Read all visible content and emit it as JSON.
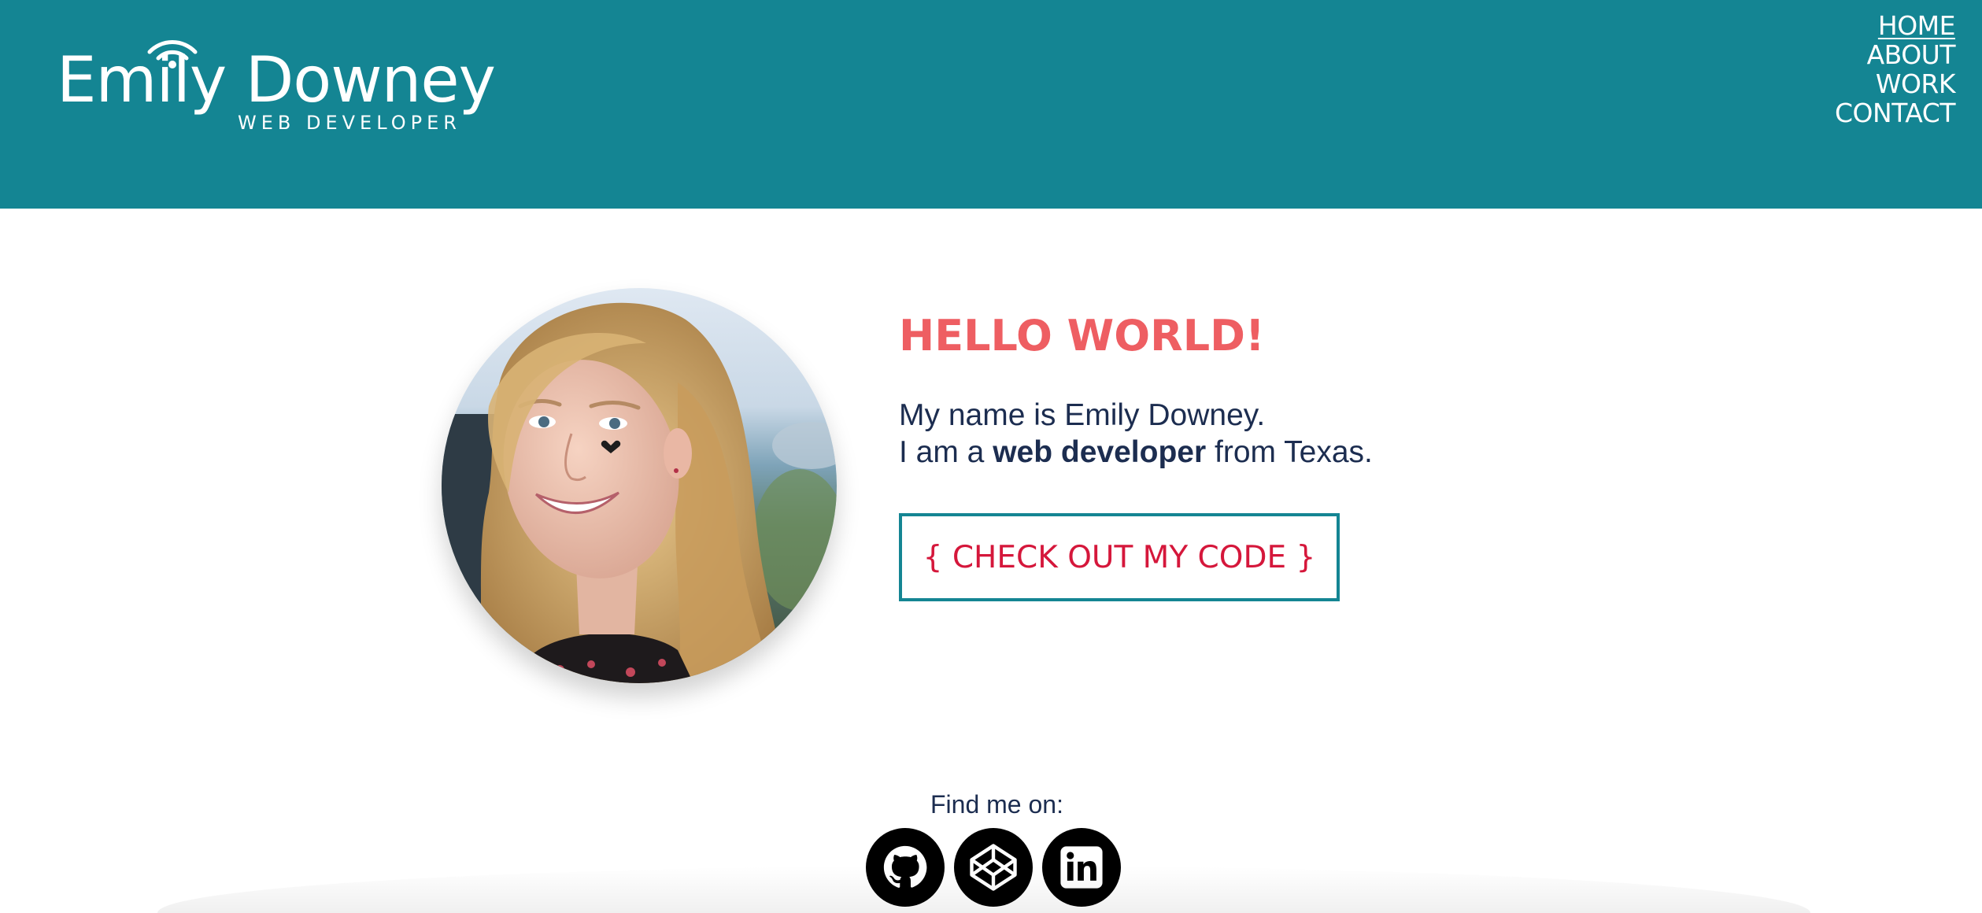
{
  "brand": {
    "name": "Emily Downey",
    "subtitle": "WEB DEVELOPER"
  },
  "nav": {
    "items": [
      {
        "label": "HOME",
        "active": true
      },
      {
        "label": "ABOUT",
        "active": false
      },
      {
        "label": "WORK",
        "active": false
      },
      {
        "label": "CONTACT",
        "active": false
      }
    ]
  },
  "hero": {
    "title": "HELLO WORLD!",
    "line1": "My name is Emily Downey.",
    "line2_prefix": "I am a ",
    "line2_bold": "web developer",
    "line2_suffix": " from Texas.",
    "cta_label": "{ CHECK OUT MY CODE }"
  },
  "social": {
    "label": "Find me on:",
    "icons": [
      "github-icon",
      "codepen-icon",
      "linkedin-icon"
    ]
  },
  "colors": {
    "header_bg": "#148593",
    "title": "#ee5e62",
    "text": "#1c2d50",
    "cta_text": "#d5173b",
    "cta_border": "#148593"
  }
}
